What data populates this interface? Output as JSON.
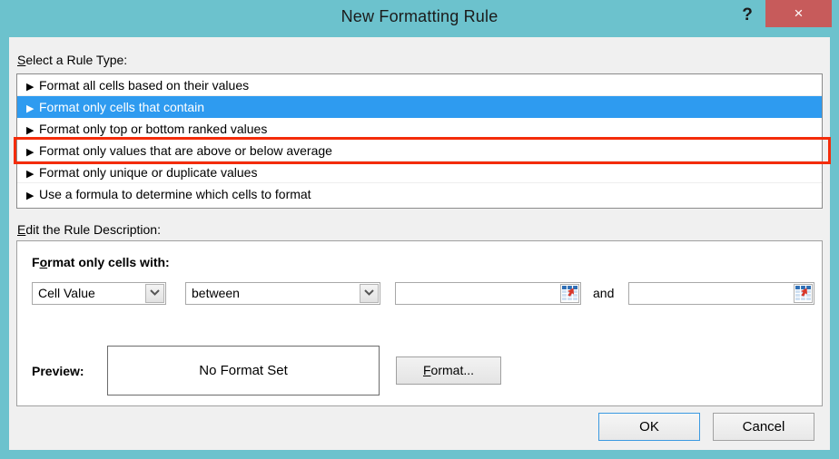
{
  "window": {
    "title": "New Formatting Rule",
    "titlebar_color": "#6cc2cd",
    "help_icon": "?",
    "close_icon": "×",
    "close_button_color": "#c75b5b"
  },
  "rule_type": {
    "label": "Select a Rule Type:",
    "label_accesskey": "S",
    "items": [
      {
        "label": "Format all cells based on their values",
        "selected": false
      },
      {
        "label": "Format only cells that contain",
        "selected": true
      },
      {
        "label": "Format only top or bottom ranked values",
        "selected": false
      },
      {
        "label": "Format only values that are above or below average",
        "selected": false
      },
      {
        "label": "Format only unique or duplicate values",
        "selected": false
      },
      {
        "label": "Use a formula to determine which cells to format",
        "selected": false
      }
    ],
    "bullet_icon": "▶",
    "selection_color": "#2e9bf0",
    "annotation_color": "#f42c0a"
  },
  "rule_description": {
    "label": "Edit the Rule Description:",
    "label_accesskey": "E",
    "heading": "Format only cells with:",
    "heading_accesskey": "o",
    "condition": {
      "subject_value": "Cell Value",
      "operator_value": "between",
      "value1": "",
      "value1_placeholder": "",
      "value2": "",
      "value2_placeholder": "",
      "conjunction": "and",
      "dropdown_icon": "⌄",
      "range_picker_icon": "range-picker-icon"
    },
    "preview": {
      "label": "Preview:",
      "text": "No Format Set",
      "format_button": "Format...",
      "format_button_accesskey": "F"
    }
  },
  "footer": {
    "ok_label": "OK",
    "cancel_label": "Cancel"
  }
}
